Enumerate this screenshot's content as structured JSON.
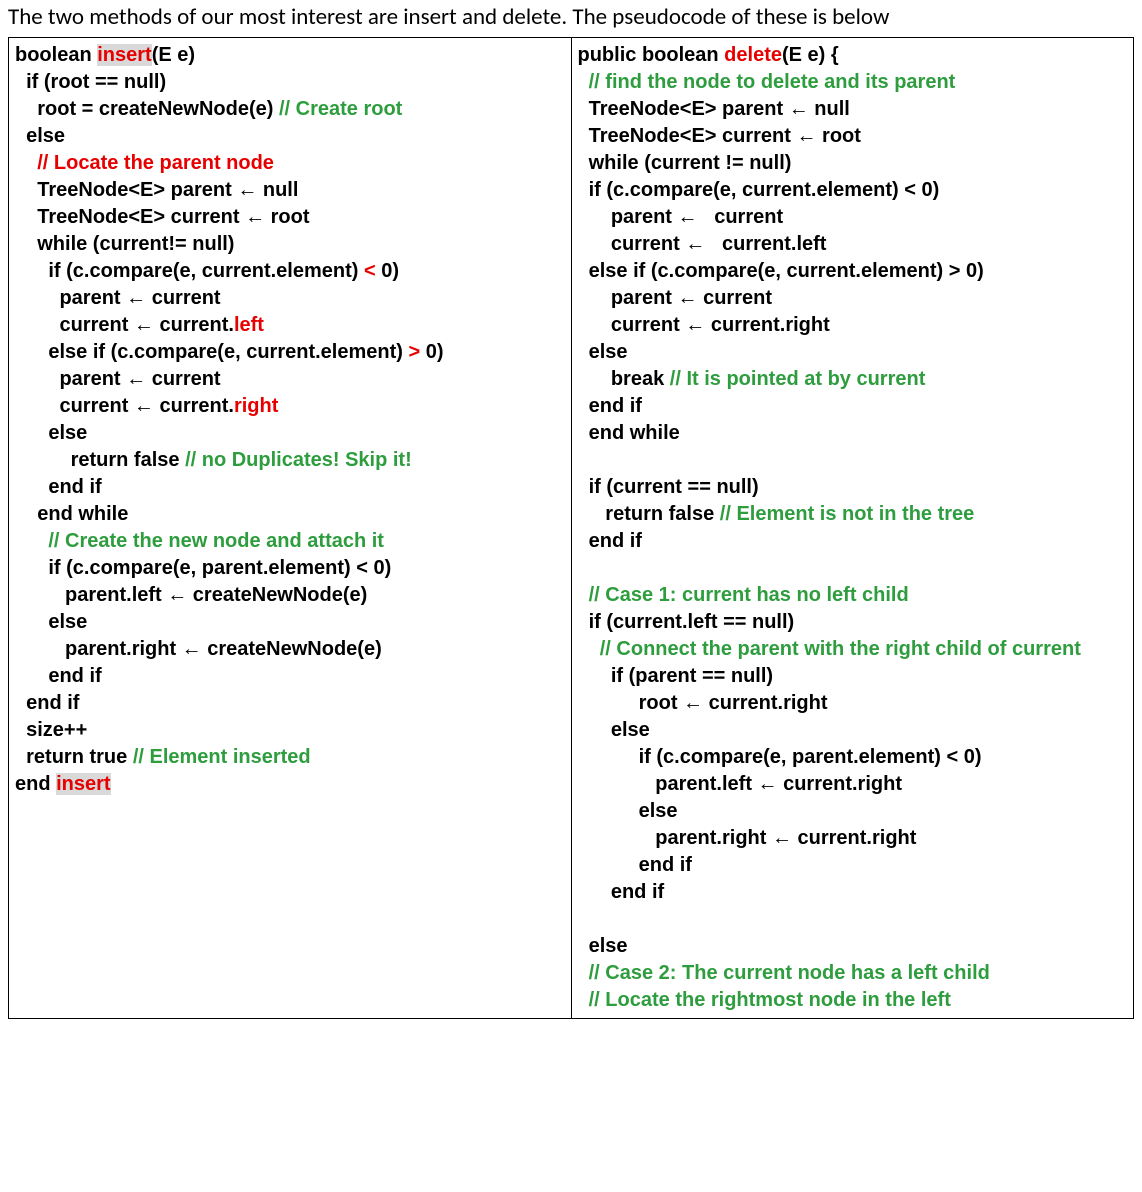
{
  "caption": "The two methods of our most interest are insert and delete. The pseudocode of these is below",
  "insert": {
    "sig_pre": "boolean ",
    "sig_name": "insert",
    "sig_post": "(E e)",
    "l2": "  if (root == null)",
    "l3a": "    root = createNewNode(e) ",
    "l3b": "// Create root",
    "l4": "  else",
    "l5": "    // Locate the parent node",
    "l6": "    TreeNode<E> parent ← null",
    "l7": "    TreeNode<E> current ← root",
    "l8": "    while (current!= null)",
    "l9a": "      if (c.compare(e, current.element) ",
    "l9b": "<",
    "l9c": " 0)",
    "l10": "        parent ← current",
    "l11a": "        current ← current.",
    "l11b": "left",
    "l12a": "      else if (c.compare(e, current.element) ",
    "l12b": ">",
    "l12c": " 0)",
    "l13": "        parent ← current",
    "l14a": "        current ← current.",
    "l14b": "right",
    "l15": "      else",
    "l16a": "          return false ",
    "l16b": "// no Duplicates! Skip it!",
    "l17": "      end if",
    "l18": "    end while",
    "l19": "      // Create the new node and attach it",
    "l20": "      if (c.compare(e, parent.element) < 0)",
    "l21": "         parent.left ← createNewNode(e)",
    "l22": "      else",
    "l23": "         parent.right ← createNewNode(e)",
    "l24": "      end if",
    "l25": "  end if",
    "l26": "  size++",
    "l27a": "  return true ",
    "l27b": "// Element inserted",
    "l28a": "end ",
    "l28b": "insert"
  },
  "del": {
    "sig_pre": "public boolean ",
    "sig_name": "delete",
    "sig_post": "(E e) {",
    "d2": "  // find the node to delete and its parent",
    "d3": "  TreeNode<E> parent ← null",
    "d4": "  TreeNode<E> current ← root",
    "d5": "  while (current != null)",
    "d6": "  if (c.compare(e, current.element) < 0)",
    "d7": "      parent ←   current",
    "d8": "      current ←   current.left",
    "d9": "  else if (c.compare(e, current.element) > 0)",
    "d10": "      parent ← current",
    "d11": "      current ← current.right",
    "d12": "  else",
    "d13a": "      break ",
    "d13b": "// It is pointed at by current",
    "d14": "  end if",
    "d15": "  end while",
    "blank1": "",
    "d16": "  if (current == null)",
    "d17a": "     return false ",
    "d17b": "// Element is not in the tree",
    "d18": "  end if",
    "blank2": "",
    "d19": "  // Case 1: current has no left child",
    "d20": "  if (current.left == null)",
    "d21": "    // Connect the parent with the right child of current",
    "d22": "      if (parent == null)",
    "d23": "           root ← current.right",
    "d24": "      else",
    "d25": "           if (c.compare(e, parent.element) < 0)",
    "d26": "              parent.left ← current.right",
    "d27": "           else",
    "d28": "              parent.right ← current.right",
    "d29": "           end if",
    "d30": "      end if",
    "blank3": "",
    "d31": "  else",
    "d32": "  // Case 2: The current node has a left child",
    "d33": "  // Locate the rightmost node in the left"
  }
}
